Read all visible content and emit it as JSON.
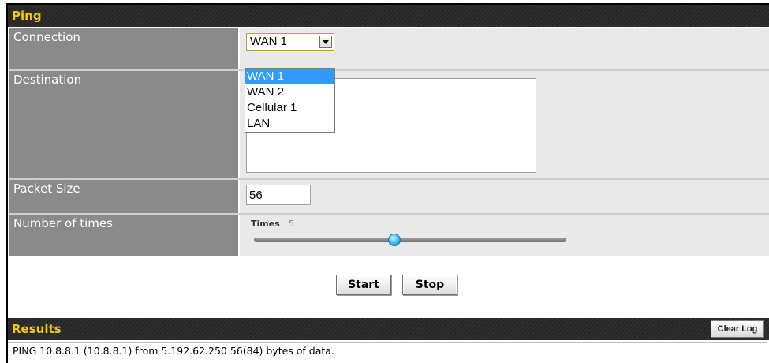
{
  "ping": {
    "title": "Ping",
    "connection": {
      "label": "Connection",
      "selected": "WAN 1",
      "options": [
        "WAN 1",
        "WAN 2",
        "Cellular 1",
        "LAN"
      ]
    },
    "destination": {
      "label": "Destination",
      "value": ""
    },
    "packet_size": {
      "label": "Packet Size",
      "value": "56"
    },
    "number_of_times": {
      "label": "Number of times",
      "slider_label": "Times",
      "value": "5",
      "fraction": 0.45
    },
    "start_label": "Start",
    "stop_label": "Stop"
  },
  "results": {
    "title": "Results",
    "clear_label": "Clear Log",
    "log_line": "PING 10.8.8.1 (10.8.8.1) from 5.192.62.250 56(84) bytes of data."
  },
  "colors": {
    "header_text": "#f5c518",
    "label_bg": "#8a8a8a",
    "value_bg": "#e9e9e9",
    "selection": "#3399ff",
    "slider_knob": "#2cb0e6"
  }
}
